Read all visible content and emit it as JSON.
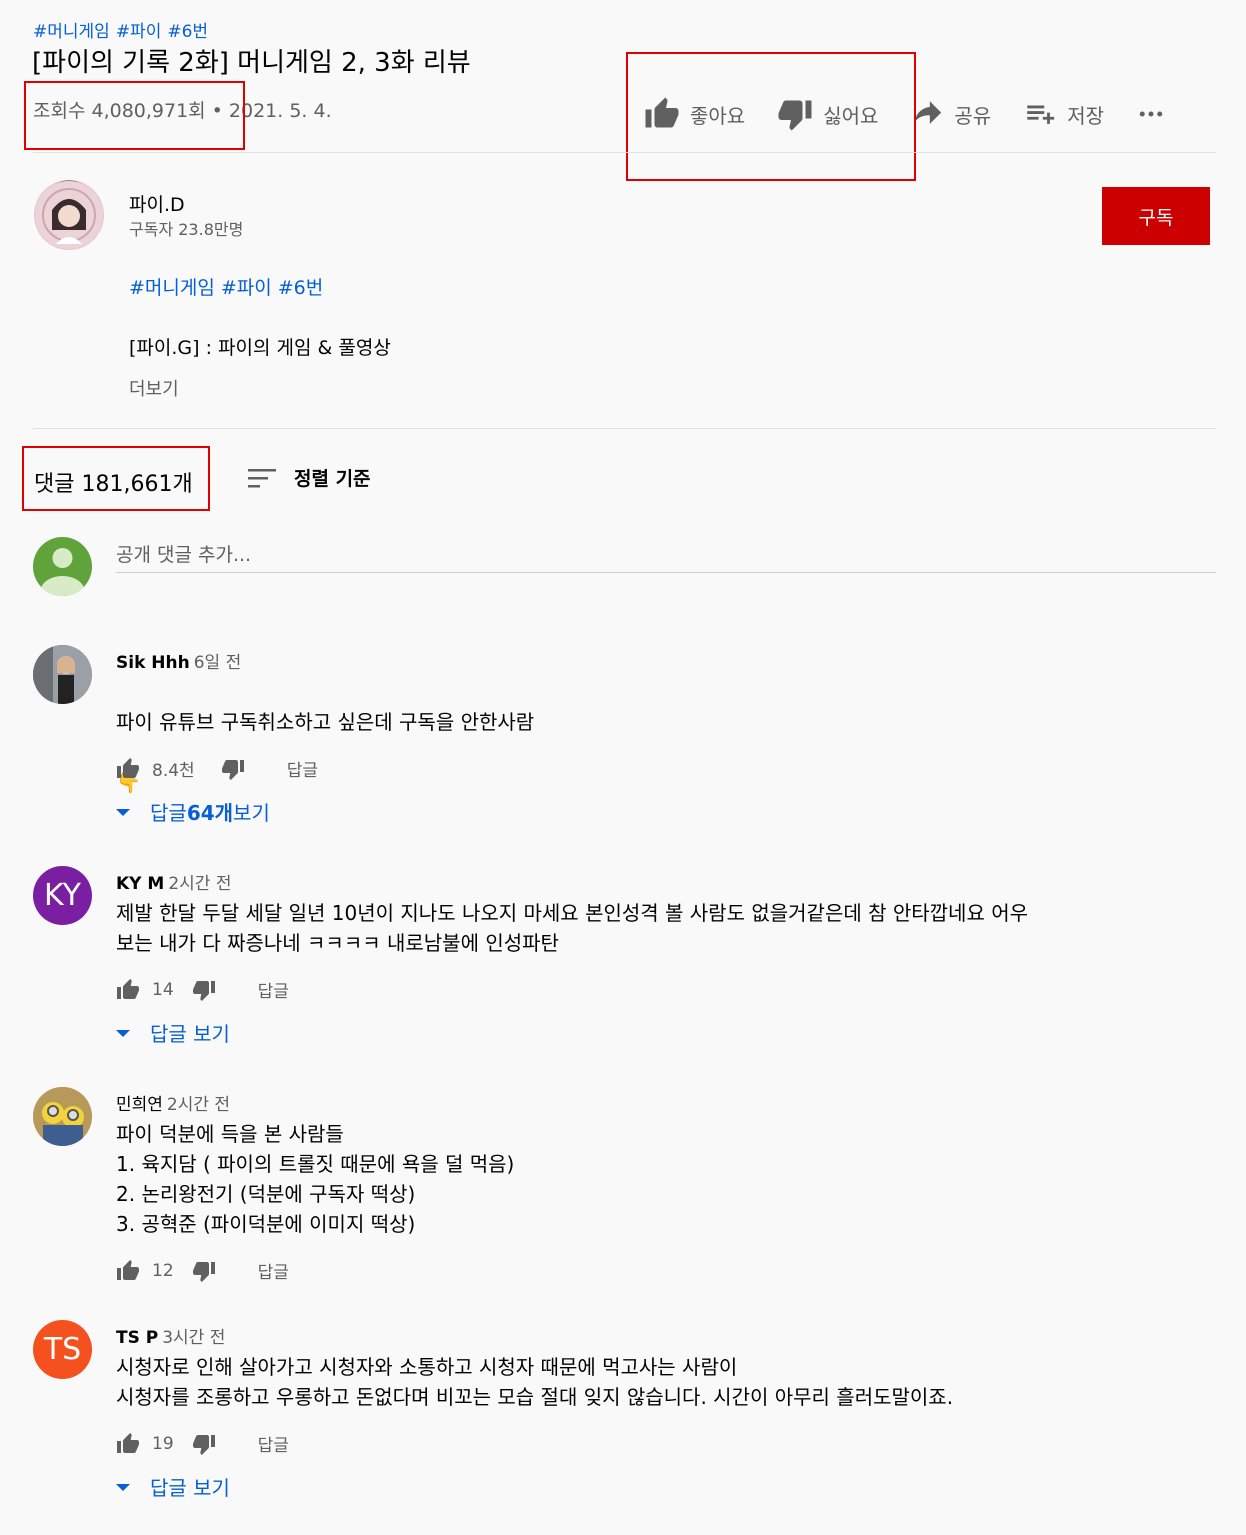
{
  "video": {
    "hashtags": [
      "#머니게임",
      "#파이",
      "#6번"
    ],
    "title": "[파이의 기록 2화] 머니게임 2, 3화 리뷰",
    "views": "조회수 4,080,971회",
    "date": "2021. 5. 4.",
    "actions": {
      "like": "좋아요",
      "dislike": "싫어요",
      "share": "공유",
      "save": "저장"
    }
  },
  "channel": {
    "name": "파이.D",
    "subscribers": "구독자 23.8만명",
    "subscribe_label": "구독"
  },
  "description": {
    "hashtags": [
      "#머니게임",
      "#파이",
      "#6번"
    ],
    "line": "[파이.G] : 파이의 게임 & 풀영상",
    "more": "더보기"
  },
  "comments_header": {
    "count": "댓글 181,661개",
    "sort": "정렬 기준",
    "placeholder": "공개 댓글 추가..."
  },
  "comments": [
    {
      "author": "Sik Hhh",
      "time": "6일 전",
      "text": "파이 유튜브 구독취소하고 싶은데 구독을 안한사람",
      "emoji": "👇",
      "likes": "8.4천",
      "reply": "답글",
      "replies_pre": "답글 ",
      "replies_count": "64개",
      "replies_post": " 보기"
    },
    {
      "author": "KY M",
      "initials": "KY",
      "avatar_color": "#7b1fa2",
      "time": "2시간 전",
      "text": "제발 한달 두달 세달 일년 10년이 지나도 나오지 마세요 본인성격 볼 사람도 없을거같은데 참 안타깝네요 어우\n보는 내가 다 짜증나네 ㅋㅋㅋㅋ 내로남불에 인성파탄",
      "likes": "14",
      "reply": "답글",
      "replies": "답글 보기"
    },
    {
      "author": "민희연",
      "time": "2시간 전",
      "text": "파이 덕분에 득을 본 사람들\n1. 육지담 ( 파이의 트롤짓 때문에 욕을 덜 먹음)\n2. 논리왕전기 (덕분에 구독자 떡상)\n3. 공혁준 (파이덕분에 이미지 떡상)",
      "likes": "12",
      "reply": "답글"
    },
    {
      "author": "TS P",
      "initials": "TS",
      "avatar_color": "#f4511e",
      "time": "3시간 전",
      "text": "시청자로 인해 살아가고 시청자와 소통하고 시청자 때문에 먹고사는 사람이\n시청자를 조롱하고 우롱하고 돈없다며 비꼬는 모습 절대 잊지 않습니다. 시간이 아무리 흘러도말이죠.",
      "likes": "19",
      "reply": "답글",
      "replies": "답글 보기"
    }
  ],
  "colors": {
    "accent": "#065fd4",
    "subscribe": "#cc0000",
    "highlight_box": "#e00000"
  }
}
